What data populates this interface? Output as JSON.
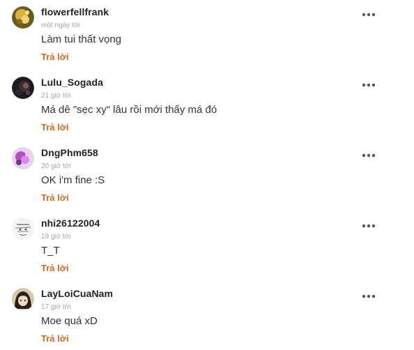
{
  "comments": [
    {
      "username": "flowerfellfrank",
      "time": "một ngày tới",
      "text": "Làm tui thất vọng",
      "reply_label": "Trả lời",
      "avatar_icon": "avatar-yellow-icon",
      "more_icon": "more-dots-icon"
    },
    {
      "username": "Lulu_Sogada",
      "time": "21 giờ tới",
      "text": "Má dê \"sẹc xy\" lâu rồi mới thấy má đó",
      "reply_label": "Trả lời",
      "avatar_icon": "avatar-dark-icon",
      "more_icon": "more-dots-icon"
    },
    {
      "username": "DngPhm658",
      "time": "20 giờ tới",
      "text": "OK i'm fine :S",
      "reply_label": "Trả lời",
      "avatar_icon": "avatar-purple-icon",
      "more_icon": "more-dots-icon"
    },
    {
      "username": "nhi26122004",
      "time": "19 giờ tới",
      "text": "T_T",
      "reply_label": "Trả lời",
      "avatar_icon": "avatar-sketch-icon",
      "more_icon": "more-dots-icon"
    },
    {
      "username": "LayLoiCuaNam",
      "time": "17 giờ tới",
      "text": "Moe quá xD",
      "reply_label": "Trả lời",
      "avatar_icon": "avatar-girl-icon",
      "more_icon": "more-dots-icon"
    }
  ],
  "colors": {
    "reply": "#d16a1f",
    "username": "#222222",
    "time": "#a5a5a5",
    "text": "#333333"
  }
}
